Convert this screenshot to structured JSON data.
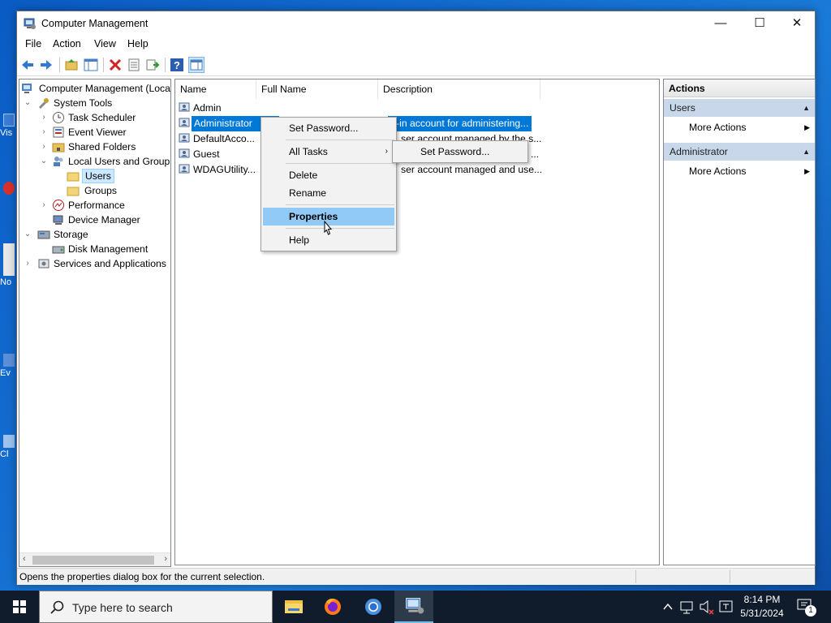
{
  "window": {
    "title": "Computer Management",
    "controls": {
      "minimize": "—",
      "maximize": "☐",
      "close": "✕"
    }
  },
  "menubar": {
    "items": [
      "File",
      "Action",
      "View",
      "Help"
    ]
  },
  "toolbar": {
    "icons": [
      "back-arrow-icon",
      "forward-arrow-icon",
      "up-folder-icon",
      "show-hide-tree-icon",
      "delete-icon",
      "properties-icon",
      "export-list-icon",
      "help-icon",
      "show-action-pane-icon"
    ]
  },
  "tree": {
    "root": "Computer Management (Local",
    "system_tools": "System Tools",
    "task_scheduler": "Task Scheduler",
    "event_viewer": "Event Viewer",
    "shared_folders": "Shared Folders",
    "local_users_groups": "Local Users and Groups",
    "users": "Users",
    "groups": "Groups",
    "performance": "Performance",
    "device_manager": "Device Manager",
    "storage": "Storage",
    "disk_management": "Disk Management",
    "services_apps": "Services and Applications"
  },
  "list": {
    "columns": [
      "Name",
      "Full Name",
      "Description"
    ],
    "rows": [
      {
        "name": "Admin",
        "full_name": "",
        "description": ""
      },
      {
        "name": "Administrator",
        "full_name": "",
        "description": "lt-in account for administering..."
      },
      {
        "name": "DefaultAcco...",
        "full_name": "",
        "description": "ser account managed by the s..."
      },
      {
        "name": "Guest",
        "full_name": "",
        "description": "..."
      },
      {
        "name": "WDAGUtility...",
        "full_name": "",
        "description": "ser account managed and use..."
      }
    ]
  },
  "context_menu": {
    "set_password": "Set Password...",
    "all_tasks": "All Tasks",
    "delete": "Delete",
    "rename": "Rename",
    "properties": "Properties",
    "help": "Help"
  },
  "submenu": {
    "set_password": "Set Password..."
  },
  "actions": {
    "header": "Actions",
    "section1": "Users",
    "section1_more": "More Actions",
    "section2": "Administrator",
    "section2_more": "More Actions"
  },
  "status": {
    "text": "Opens the properties dialog box for the current selection."
  },
  "desktop_fragments": [
    "Vis",
    "No",
    "Ev",
    "Cl"
  ],
  "taskbar": {
    "search_placeholder": "Type here to search",
    "time": "8:14 PM",
    "date": "5/31/2024",
    "notification_count": "1"
  },
  "colors": {
    "selection": "#0078d7",
    "menu_highlight": "#91c9f7",
    "action_section": "#c8d8ea",
    "taskbar": "#101c2c"
  }
}
